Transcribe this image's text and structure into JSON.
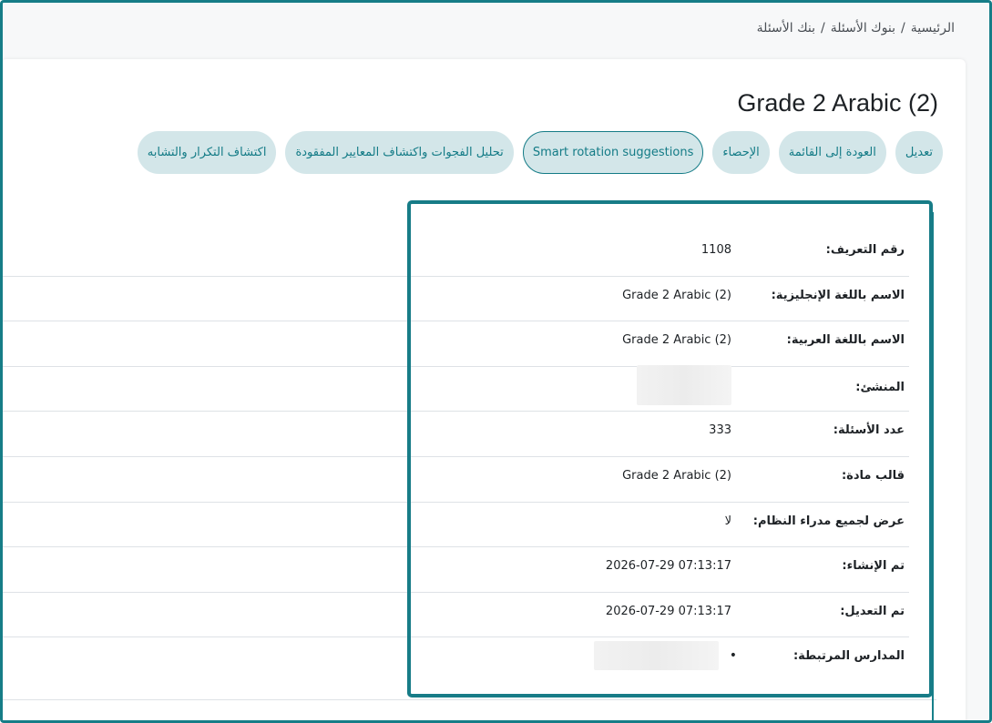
{
  "breadcrumb": {
    "home": "الرئيسية",
    "sep": "/",
    "banks": "بنوك الأسئلة",
    "current": "بنك الأسئلة"
  },
  "page_title": "Grade 2 Arabic (2)",
  "actions": {
    "edit": "تعديل",
    "back": "العودة إلى القائمة",
    "stats": "الإحصاء",
    "smart": "Smart rotation suggestions",
    "gaps": "تحليل الفجوات واكتشاف المعايير المفقودة",
    "dup": "اكتشاف التكرار والتشابه"
  },
  "details": {
    "id_label": "رقم التعريف:",
    "id_value": "1108",
    "name_en_label": "الاسم باللغة الإنجليزية:",
    "name_en_value": "Grade 2 Arabic (2)",
    "name_ar_label": "الاسم باللغة العربية:",
    "name_ar_value": "Grade 2 Arabic (2)",
    "creator_label": "المنشئ:",
    "count_label": "عدد الأسئلة:",
    "count_value": "333",
    "template_label": "قالب مادة:",
    "template_value": "Grade 2 Arabic (2)",
    "show_all_label": "عرض لجميع مدراء النظام:",
    "show_all_value": "لا",
    "created_label": "تم الإنشاء:",
    "created_value": "2026-07-29 07:13:17",
    "modified_label": "تم التعديل:",
    "modified_value": "2026-07-29 07:13:17",
    "schools_label": "المدارس المرتبطة:",
    "schools_bullet": "•"
  },
  "colors": {
    "accent": "#167d87",
    "pill_bg": "#d3e6e9"
  }
}
